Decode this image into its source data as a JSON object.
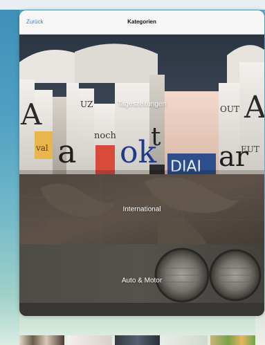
{
  "nav": {
    "back_label": "Zurück",
    "title": "Kategorien"
  },
  "categories": [
    {
      "label": "Tageszeitungen",
      "image": "newspapers-photo"
    },
    {
      "label": "International",
      "image": "world-map-photo"
    },
    {
      "label": "Auto & Motor",
      "image": "car-headlights-photo"
    }
  ],
  "colors": {
    "accent": "#2f7ef6",
    "nav_bg": "#f7f7f7"
  }
}
